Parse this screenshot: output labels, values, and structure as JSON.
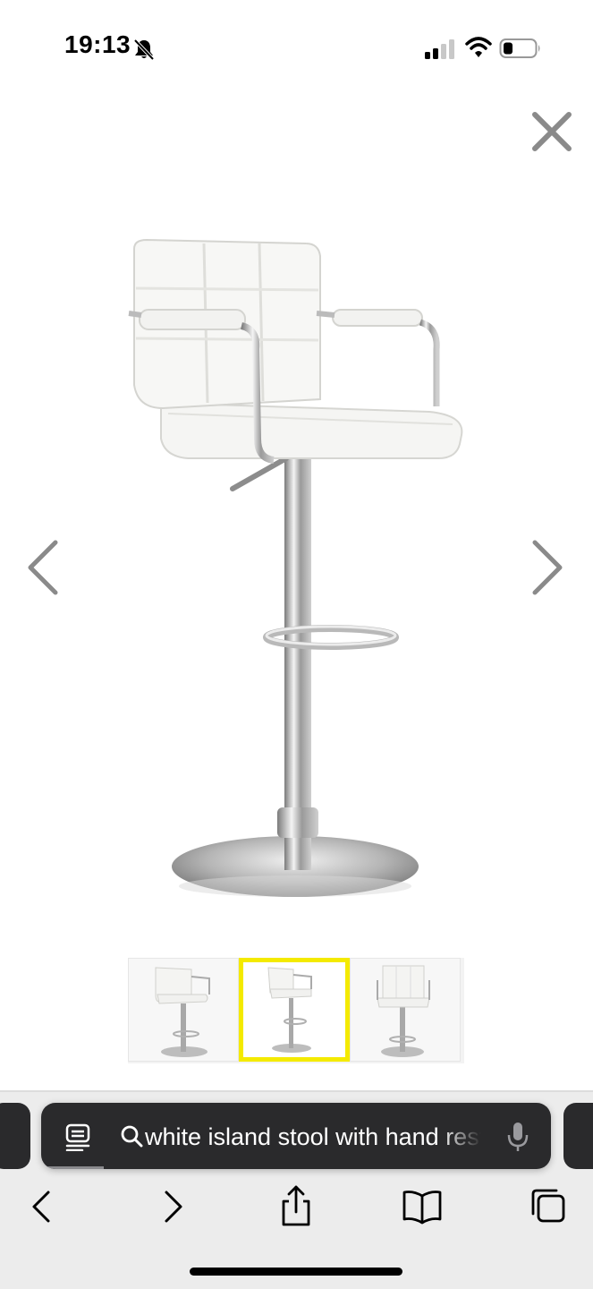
{
  "status_bar": {
    "time": "19:13",
    "icons": [
      "bell-slash-icon",
      "cellular-signal-icon",
      "wifi-icon",
      "battery-icon"
    ]
  },
  "viewer": {
    "icons": [
      "close-icon",
      "chevron-left-icon",
      "chevron-right-icon"
    ],
    "main_image": "white-bar-stool-with-armrests",
    "thumbnails": [
      {
        "image": "stool-angle-view",
        "selected": false
      },
      {
        "image": "stool-side-view",
        "selected": true
      },
      {
        "image": "stool-back-view",
        "selected": false
      }
    ],
    "selected_border_color": "#f4ea00"
  },
  "browser": {
    "address_bar": {
      "text": "white island stool with hand rest",
      "icons": [
        "page-menu-icon",
        "search-icon",
        "microphone-icon"
      ]
    },
    "toolbar": {
      "icons": [
        "back-icon",
        "forward-icon",
        "share-icon",
        "bookmarks-icon",
        "tabs-icon"
      ]
    }
  }
}
